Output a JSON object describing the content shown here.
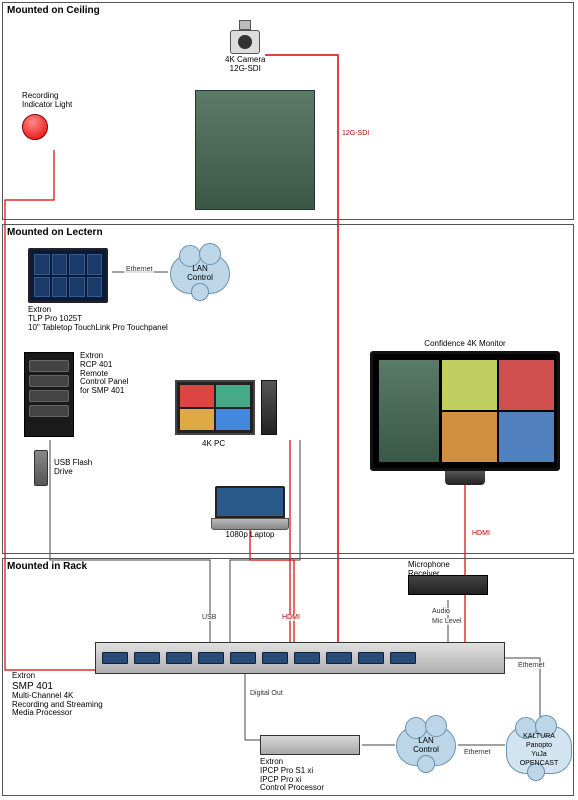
{
  "sections": {
    "ceiling": "Mounted on Ceiling",
    "lectern": "Mounted on Lectern",
    "rack": "Mounted in Rack"
  },
  "ceiling": {
    "camera": {
      "title": "4K Camera",
      "subtitle": "12G-SDI"
    },
    "light": {
      "title": "Recording",
      "subtitle": "Indicator Light"
    }
  },
  "lectern": {
    "touchpanel": {
      "brand": "Extron",
      "model": "TLP Pro 1025T",
      "desc": "10\" Tabletop TouchLink Pro Touchpanel"
    },
    "rcp": {
      "brand": "Extron",
      "model": "RCP 401",
      "desc1": "Remote",
      "desc2": "Control Panel",
      "desc3": "for SMP 401"
    },
    "usb": {
      "title": "USB Flash",
      "subtitle": "Drive"
    },
    "pc": {
      "title": "4K PC"
    },
    "laptop": {
      "title": "1080p Laptop"
    },
    "monitor": {
      "title": "Confidence 4K Monitor"
    }
  },
  "rack": {
    "mic": {
      "title": "Microphone",
      "subtitle": "Receiver"
    },
    "smp": {
      "brand": "Extron",
      "model": "SMP 401",
      "desc1": "Multi-Channel 4K",
      "desc2": "Recording and Streaming",
      "desc3": "Media Processor"
    },
    "ipcp": {
      "brand": "Extron",
      "model": "IPCP Pro S1 xi",
      "desc1": "IPCP Pro xi",
      "desc2": "Control Processor"
    }
  },
  "clouds": {
    "lan1": "LAN\nControl",
    "lan2": "LAN\nControl",
    "cdn": {
      "items": [
        "KALTURA",
        "Panopto",
        "YuJa",
        "OPENCAST"
      ]
    }
  },
  "wires": {
    "ethernet": "Ethernet",
    "sdi": "12G-SDI",
    "hdmi": "HDMI",
    "usb": "USB",
    "audio": "Audio",
    "mic": "Mic Level",
    "digital": "Digital Out"
  }
}
